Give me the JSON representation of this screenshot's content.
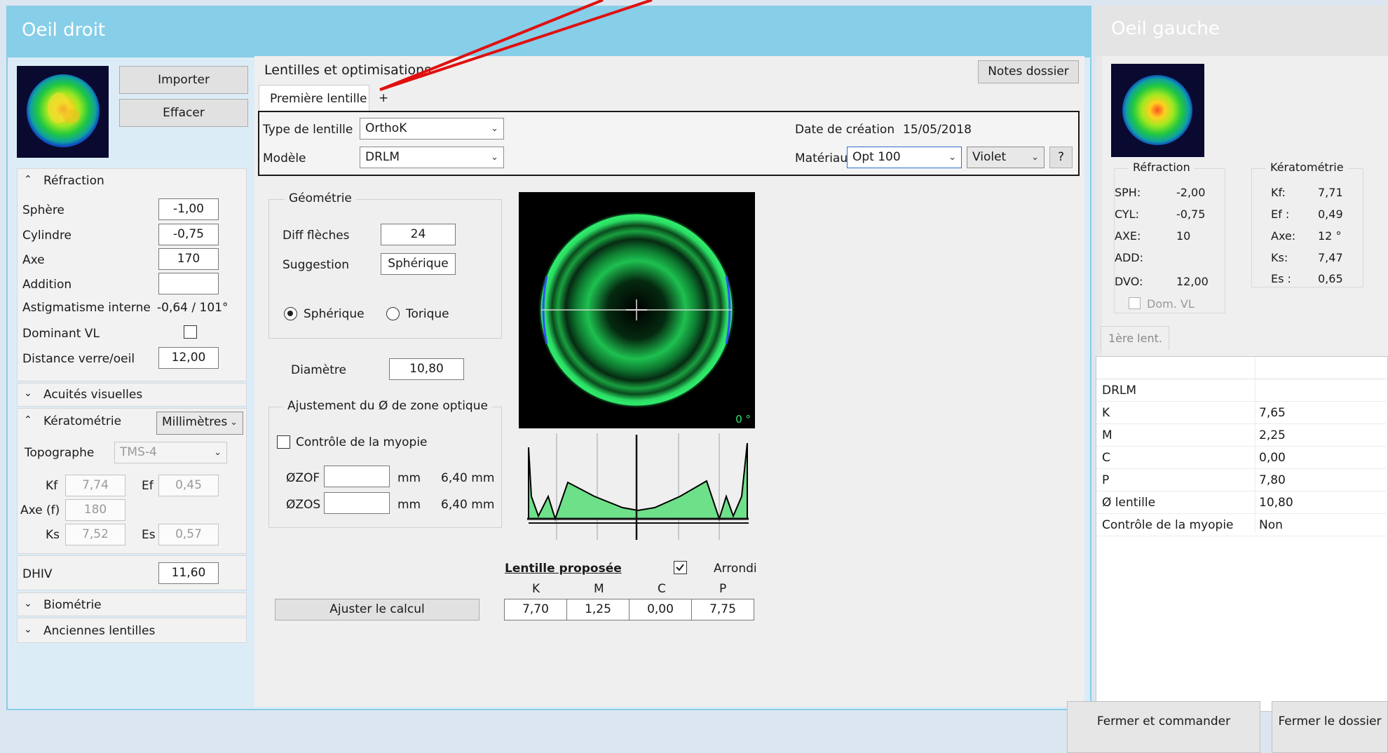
{
  "right_eye": {
    "title": "Oeil droit",
    "import_label": "Importer",
    "clear_label": "Effacer",
    "refraction": {
      "header": "Réfraction",
      "sphere_label": "Sphère",
      "sphere_value": "-1,00",
      "cylinder_label": "Cylindre",
      "cylinder_value": "-0,75",
      "axis_label": "Axe",
      "axis_value": "170",
      "addition_label": "Addition",
      "addition_value": "",
      "internal_astig_label": "Astigmatisme interne",
      "internal_astig_value": "-0,64 / 101°",
      "dominant_label": "Dominant VL",
      "vertex_label": "Distance verre/oeil",
      "vertex_value": "12,00"
    },
    "acuity_header": "Acuités visuelles",
    "keratometry": {
      "header": "Kératométrie",
      "unit_select": "Millimètres",
      "topographer_label": "Topographe",
      "topographer_value": "TMS-4",
      "kf_label": "Kf",
      "kf_value": "7,74",
      "ef_label": "Ef",
      "ef_value": "0,45",
      "axef_label": "Axe (f)",
      "axef_value": "180",
      "ks_label": "Ks",
      "ks_value": "7,52",
      "es_label": "Es",
      "es_value": "0,57"
    },
    "dhiv_label": "DHIV",
    "dhiv_value": "11,60",
    "biometry_header": "Biométrie",
    "old_lenses_header": "Anciennes lentilles"
  },
  "lens_panel": {
    "title": "Lentilles et optimisations",
    "notes_label": "Notes dossier",
    "tab_first": "Première lentille",
    "tab_add": "+",
    "lens_type_label": "Type de lentille",
    "lens_type_value": "OrthoK",
    "model_label": "Modèle",
    "model_value": "DRLM",
    "creation_label": "Date de création",
    "creation_value": "15/05/2018",
    "material_label": "Matériau",
    "material_value": "Opt 100",
    "color_value": "Violet",
    "help_label": "?",
    "geometry": {
      "header": "Géométrie",
      "diff_label": "Diff flèches",
      "diff_value": "24",
      "suggestion_label": "Suggestion",
      "suggestion_value": "Sphérique",
      "radio_spherical": "Sphérique",
      "radio_toric": "Torique"
    },
    "diameter_label": "Diamètre",
    "diameter_value": "10,80",
    "optic_zone": {
      "header": "Ajustement du Ø de zone optique",
      "myopia_label": "Contrôle de la myopie",
      "zof_label": "ØZOF",
      "zof_value": "",
      "zof_unit": "mm",
      "zof_calc": "6,40 mm",
      "zos_label": "ØZOS",
      "zos_value": "",
      "zos_unit": "mm",
      "zos_calc": "6,40 mm"
    },
    "fluo_angle": "0 °",
    "adjust_label": "Ajuster le calcul",
    "proposed": {
      "title": "Lentille proposée",
      "rounded_label": "Arrondi",
      "headers": [
        "K",
        "M",
        "C",
        "P"
      ],
      "values": [
        "7,70",
        "1,25",
        "0,00",
        "7,75"
      ]
    }
  },
  "left_eye": {
    "title": "Oeil gauche",
    "refraction_header": "Réfraction",
    "sph_label": "SPH:",
    "sph_value": "-2,00",
    "cyl_label": "CYL:",
    "cyl_value": "-0,75",
    "axe_label": "AXE:",
    "axe_value": "10",
    "add_label": "ADD:",
    "add_value": "",
    "dvo_label": "DVO:",
    "dvo_value": "12,00",
    "dom_label": "Dom. VL",
    "kerato_header": "Kératométrie",
    "kf_label": "Kf:",
    "kf_value": "7,71",
    "ef_label": "Ef :",
    "ef_value": "0,49",
    "axe2_label": "Axe:",
    "axe2_value": "12 °",
    "ks_label": "Ks:",
    "ks_value": "7,47",
    "es_label": "Es :",
    "es_value": "0,65",
    "tab_label": "1ère lent.",
    "table": [
      {
        "label": "DRLM",
        "value": ""
      },
      {
        "label": "K",
        "value": "7,65"
      },
      {
        "label": "M",
        "value": "2,25"
      },
      {
        "label": "C",
        "value": "0,00"
      },
      {
        "label": "P",
        "value": "7,80"
      },
      {
        "label": "Ø lentille",
        "value": "10,80"
      },
      {
        "label": "Contrôle de la myopie",
        "value": "Non"
      }
    ]
  },
  "footer": {
    "order_label": "Fermer et commander",
    "close_label": "Fermer le dossier"
  },
  "colors": {
    "header_blue": "#87cee9",
    "panel_light": "#dcecf7",
    "fluo_green": "#2ee86a",
    "arrow_red": "#e01010"
  }
}
